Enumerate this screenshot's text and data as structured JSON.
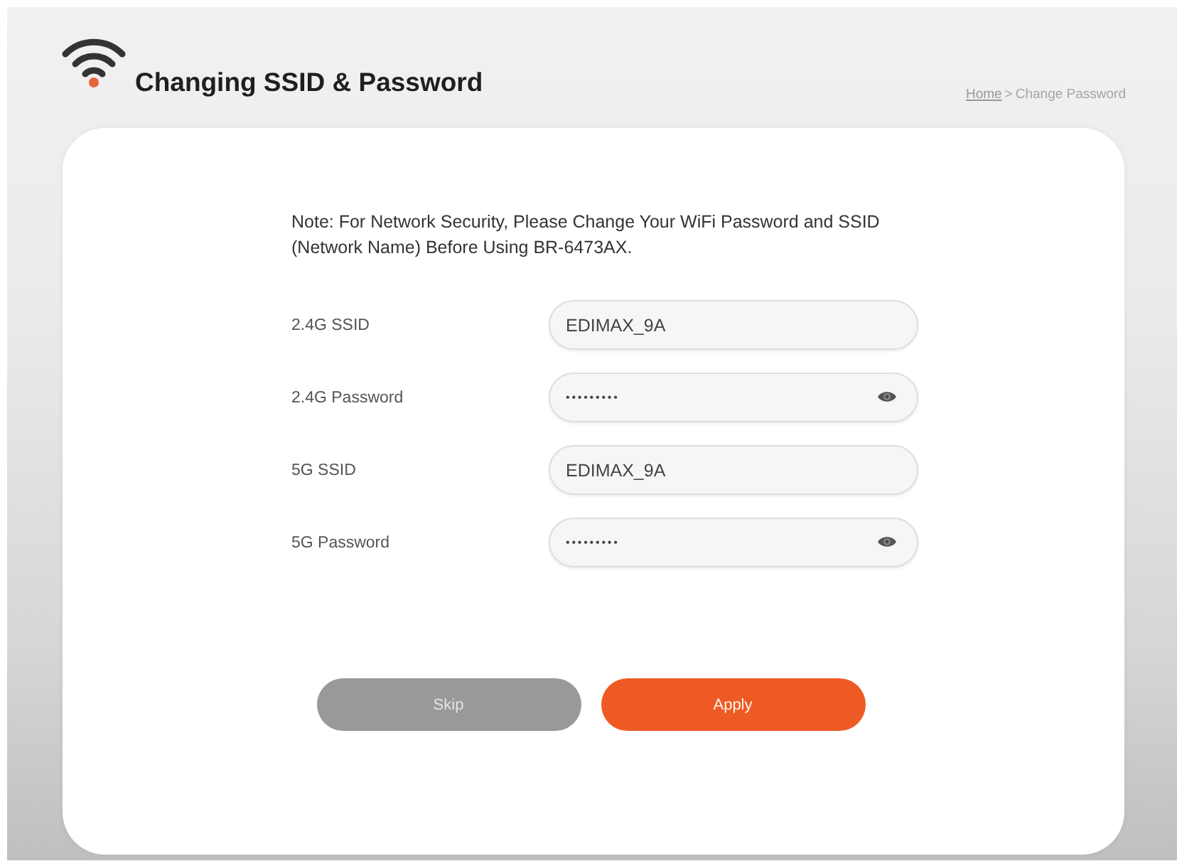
{
  "header": {
    "title": "Changing SSID & Password",
    "breadcrumb": {
      "separator": ">",
      "items": [
        {
          "label": "Home",
          "kind": "link"
        },
        {
          "label": "Change Password",
          "kind": "current"
        }
      ]
    }
  },
  "note": "Note: For Network Security, Please Change Your WiFi Password and SSID (Network Name) Before Using BR-6473AX.",
  "fields": [
    {
      "label": "2.4G SSID",
      "kind": "text",
      "value": "EDIMAX_9A"
    },
    {
      "label": "2.4G Password",
      "kind": "password",
      "value": "•••••••••"
    },
    {
      "label": "5G SSID",
      "kind": "text",
      "value": "EDIMAX_9A"
    },
    {
      "label": "5G Password",
      "kind": "password",
      "value": "•••••••••"
    }
  ],
  "buttons": [
    {
      "label": "Skip",
      "kind": "secondary"
    },
    {
      "label": "Apply",
      "kind": "primary"
    }
  ]
}
